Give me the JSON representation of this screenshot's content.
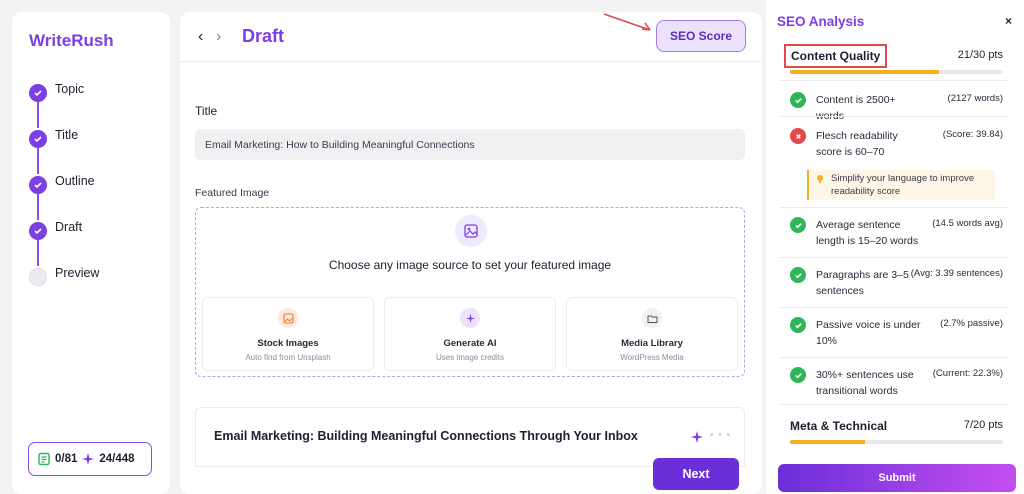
{
  "sidebar": {
    "brand": "WriteRush",
    "steps": [
      {
        "label": "Topic",
        "done": true
      },
      {
        "label": "Title",
        "done": true
      },
      {
        "label": "Outline",
        "done": true
      },
      {
        "label": "Draft",
        "done": true
      },
      {
        "label": "Preview",
        "done": false
      }
    ],
    "credits": {
      "articles": "0/81",
      "images": "24/448"
    }
  },
  "header": {
    "title": "Draft",
    "seo_button": "SEO Score"
  },
  "form": {
    "title_label": "Title",
    "title_value": "Email Marketing: How to Building Meaningful Connections",
    "featured_label": "Featured Image",
    "dropzone_text": "Choose any image source to set your featured image",
    "options": [
      {
        "title": "Stock Images",
        "sub": "Auto find from Unsplash"
      },
      {
        "title": "Generate AI",
        "sub": "Uses image credits"
      },
      {
        "title": "Media Library",
        "sub": "WordPress Media"
      }
    ],
    "article_heading": "Email Marketing: Building Meaningful Connections Through Your Inbox",
    "next_button": "Next"
  },
  "seo": {
    "title": "SEO Analysis",
    "close": "×",
    "content_quality": {
      "name": "Content Quality",
      "points": "21/30 pts",
      "fraction": 0.7
    },
    "checks": [
      {
        "text": "Content is 2500+ words",
        "value": "(2127 words)",
        "status": "pass"
      },
      {
        "text": "Flesch readability score is 60–70",
        "value": "(Score: 39.84)",
        "status": "fail"
      },
      {
        "text": "Average sentence length is 15–20 words",
        "value": "(14.5 words avg)",
        "status": "pass"
      },
      {
        "text": "Paragraphs are 3–5 sentences",
        "value": "(Avg: 3.39 sentences)",
        "status": "pass"
      },
      {
        "text": "Passive voice is under 10%",
        "value": "(2.7% passive)",
        "status": "pass"
      },
      {
        "text": "30%+ sentences use transitional words",
        "value": "(Current: 22.3%)",
        "status": "pass"
      }
    ],
    "tip": "Simplify your language to improve readability score",
    "meta": {
      "name": "Meta & Technical",
      "points": "7/20 pts",
      "fraction": 0.35
    },
    "submit": "Submit"
  },
  "colors": {
    "accent": "#7b3fe4",
    "pass": "#2fb55a",
    "fail": "#e04a4a",
    "progress": "#f2b01e"
  }
}
